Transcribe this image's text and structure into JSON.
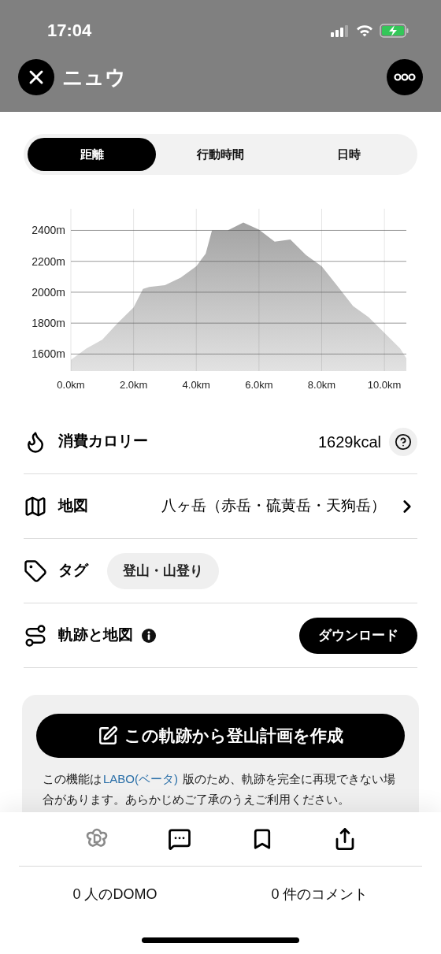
{
  "status_bar": {
    "time": "17:04"
  },
  "header": {
    "title": "ニュウ"
  },
  "segments": [
    {
      "label": "距離",
      "selected": true
    },
    {
      "label": "行動時間",
      "selected": false
    },
    {
      "label": "日時",
      "selected": false
    }
  ],
  "elevation": {
    "chart_data": {
      "type": "area",
      "xlim": [
        0,
        10.7
      ],
      "ylim": [
        1490,
        2540
      ],
      "xticks": [
        {
          "value": 0,
          "label": "0.0km"
        },
        {
          "value": 2,
          "label": "2.0km"
        },
        {
          "value": 4,
          "label": "4.0km"
        },
        {
          "value": 6,
          "label": "6.0km"
        },
        {
          "value": 8,
          "label": "8.0km"
        },
        {
          "value": 10,
          "label": "10.0km"
        }
      ],
      "yticks": [
        {
          "value": 1600,
          "label": "1600m"
        },
        {
          "value": 1800,
          "label": "1800m"
        },
        {
          "value": 2000,
          "label": "2000m"
        },
        {
          "value": 2200,
          "label": "2200m"
        },
        {
          "value": 2400,
          "label": "2400m"
        }
      ],
      "x": [
        0,
        0.5,
        1,
        1.5,
        2,
        2.3,
        2.5,
        3,
        3.5,
        4,
        4.3,
        4.5,
        5,
        5.5,
        6,
        6.5,
        7,
        7.5,
        8,
        8.5,
        9,
        9.5,
        10,
        10.5,
        10.7
      ],
      "grid": true,
      "series": [
        {
          "color": "#a3a3a3",
          "values": [
            1563,
            1637,
            1692,
            1802,
            1902,
            2021,
            2034,
            2045,
            2094,
            2168,
            2250,
            2400,
            2400,
            2451,
            2405,
            2327,
            2341,
            2241,
            2168,
            2040,
            1911,
            1838,
            1737,
            1637,
            1573
          ]
        }
      ]
    }
  },
  "rows": [
    {
      "kind": "calories",
      "label": "消費カロリー",
      "value": "1629kcal"
    },
    {
      "kind": "map",
      "label": "地図",
      "value": "八ヶ岳（赤岳・硫黄岳・天狗岳）"
    },
    {
      "kind": "tag",
      "label": "タグ",
      "tags": [
        "登山・山登り"
      ]
    },
    {
      "kind": "track",
      "label": "軌跡と地図",
      "button": "ダウンロード"
    }
  ],
  "plan_card": {
    "button": "この軌跡から登山計画を作成",
    "note_before": "この機能は",
    "note_link": "LABO(ベータ)",
    "note_after": "版のため、軌跡を完全に再現できない場合があります。あらかじめご了承のうえご利用ください。"
  },
  "counts": [
    "0 人のDOMO",
    "0 件のコメント"
  ]
}
